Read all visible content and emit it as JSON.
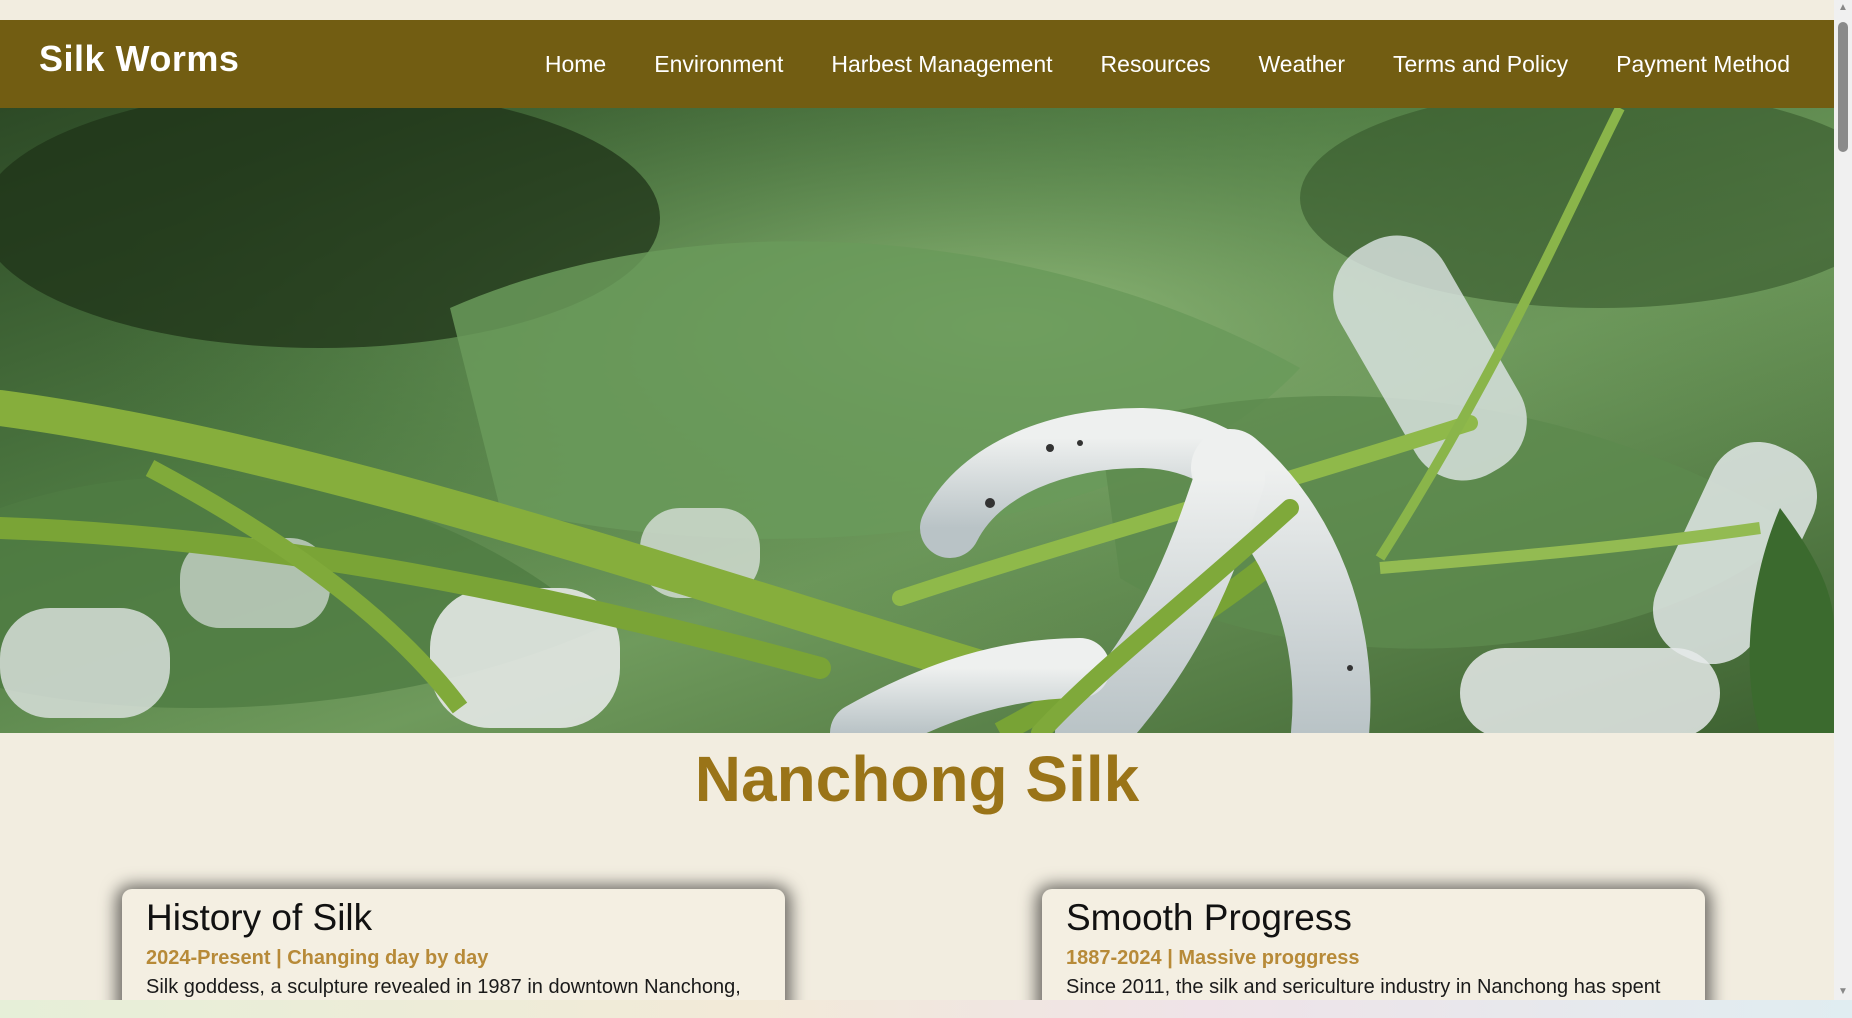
{
  "brand": "Silk Worms",
  "nav": [
    "Home",
    "Environment",
    "Harbest Management",
    "Resources",
    "Weather",
    "Terms and Policy",
    "Payment Method"
  ],
  "page_title": "Nanchong Silk",
  "cards": [
    {
      "title": "History of Silk",
      "subtitle": "2024-Present | Changing day by day",
      "text": "Silk goddess, a sculpture revealed in 1987 in downtown Nanchong,"
    },
    {
      "title": "Smooth Progress",
      "subtitle": "1887-2024 | Massive proggress",
      "text": "Since 2011, the silk and sericulture industry in Nanchong has spent"
    }
  ],
  "colors": {
    "navbar": "#725d12",
    "background": "#f2ede0",
    "title": "#9a7418",
    "subtitle": "#b78a38"
  }
}
